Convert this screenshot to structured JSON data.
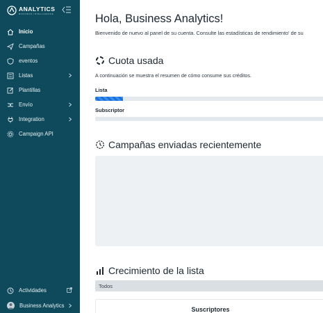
{
  "sidebar": {
    "brand": {
      "name": "ANALYTICS",
      "tagline": "BUSINESS INTELLIGENCE"
    },
    "items": [
      {
        "label": "Inicio",
        "icon": "home-icon",
        "active": true
      },
      {
        "label": "Campañas",
        "icon": "send-icon"
      },
      {
        "label": "eventos",
        "icon": "shield-icon"
      },
      {
        "label": "Listas",
        "icon": "list-icon",
        "chevron": true
      },
      {
        "label": "Plantillas",
        "icon": "edit-icon"
      },
      {
        "label": "Envío",
        "icon": "shuffle-icon",
        "chevron": true
      },
      {
        "label": "Integration",
        "icon": "plug-icon",
        "chevron": true
      },
      {
        "label": "Campaign API",
        "icon": "gear-icon"
      }
    ],
    "footer": {
      "activity_label": "Actividades",
      "user_label": "Business Analytics"
    }
  },
  "main": {
    "greeting": "Hola, Business Analytics!",
    "subtitle": "Bienvenido de nuevo al panel de su cuenta. Consulte las estadísticas de rendimiento' de su",
    "quota": {
      "title": "Cuota usada",
      "description": "A continuación se muestra el resumen de cómo consume sus créditos.",
      "bars": [
        {
          "label": "Lista",
          "progress_percent": 12
        },
        {
          "label": "Subscriptor",
          "progress_percent": 0
        }
      ]
    },
    "campaigns": {
      "title": "Campañas enviadas recientemente"
    },
    "growth": {
      "title": "Crecimiento de la lista",
      "filter_value": "Todos",
      "card_title": "Suscriptores"
    }
  },
  "colors": {
    "sidebar_bg": "#0e4a5c",
    "accent": "#1c6fd6",
    "panel_bg": "#edf1f4"
  }
}
